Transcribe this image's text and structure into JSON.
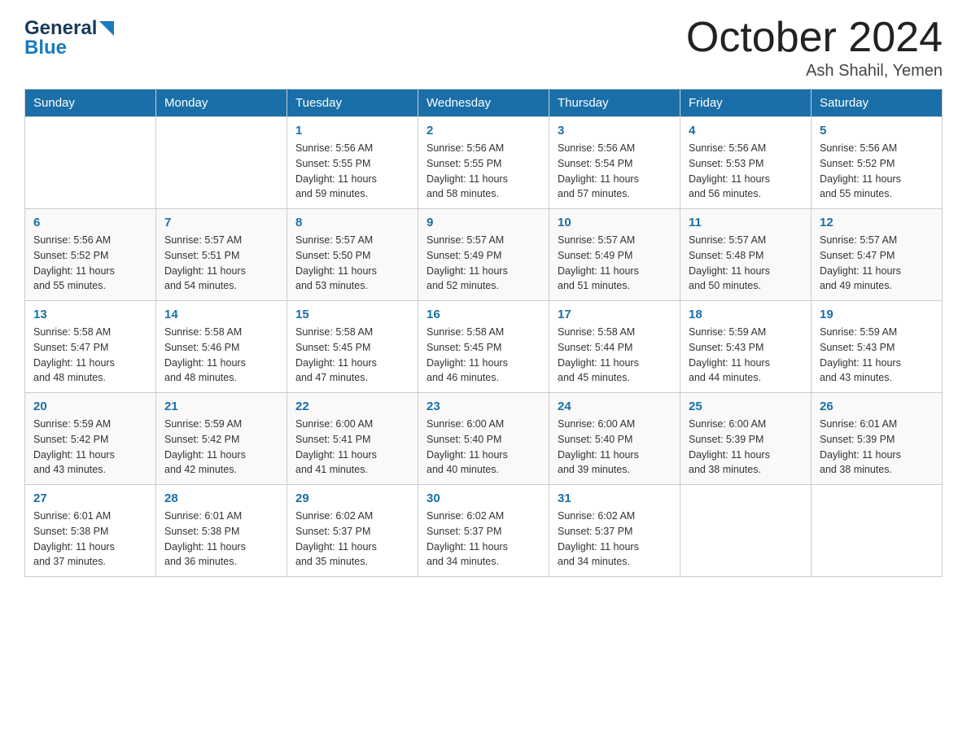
{
  "logo": {
    "general": "General",
    "blue": "Blue"
  },
  "title": "October 2024",
  "location": "Ash Shahil, Yemen",
  "weekdays": [
    "Sunday",
    "Monday",
    "Tuesday",
    "Wednesday",
    "Thursday",
    "Friday",
    "Saturday"
  ],
  "weeks": [
    [
      {
        "day": "",
        "info": ""
      },
      {
        "day": "",
        "info": ""
      },
      {
        "day": "1",
        "info": "Sunrise: 5:56 AM\nSunset: 5:55 PM\nDaylight: 11 hours\nand 59 minutes."
      },
      {
        "day": "2",
        "info": "Sunrise: 5:56 AM\nSunset: 5:55 PM\nDaylight: 11 hours\nand 58 minutes."
      },
      {
        "day": "3",
        "info": "Sunrise: 5:56 AM\nSunset: 5:54 PM\nDaylight: 11 hours\nand 57 minutes."
      },
      {
        "day": "4",
        "info": "Sunrise: 5:56 AM\nSunset: 5:53 PM\nDaylight: 11 hours\nand 56 minutes."
      },
      {
        "day": "5",
        "info": "Sunrise: 5:56 AM\nSunset: 5:52 PM\nDaylight: 11 hours\nand 55 minutes."
      }
    ],
    [
      {
        "day": "6",
        "info": "Sunrise: 5:56 AM\nSunset: 5:52 PM\nDaylight: 11 hours\nand 55 minutes."
      },
      {
        "day": "7",
        "info": "Sunrise: 5:57 AM\nSunset: 5:51 PM\nDaylight: 11 hours\nand 54 minutes."
      },
      {
        "day": "8",
        "info": "Sunrise: 5:57 AM\nSunset: 5:50 PM\nDaylight: 11 hours\nand 53 minutes."
      },
      {
        "day": "9",
        "info": "Sunrise: 5:57 AM\nSunset: 5:49 PM\nDaylight: 11 hours\nand 52 minutes."
      },
      {
        "day": "10",
        "info": "Sunrise: 5:57 AM\nSunset: 5:49 PM\nDaylight: 11 hours\nand 51 minutes."
      },
      {
        "day": "11",
        "info": "Sunrise: 5:57 AM\nSunset: 5:48 PM\nDaylight: 11 hours\nand 50 minutes."
      },
      {
        "day": "12",
        "info": "Sunrise: 5:57 AM\nSunset: 5:47 PM\nDaylight: 11 hours\nand 49 minutes."
      }
    ],
    [
      {
        "day": "13",
        "info": "Sunrise: 5:58 AM\nSunset: 5:47 PM\nDaylight: 11 hours\nand 48 minutes."
      },
      {
        "day": "14",
        "info": "Sunrise: 5:58 AM\nSunset: 5:46 PM\nDaylight: 11 hours\nand 48 minutes."
      },
      {
        "day": "15",
        "info": "Sunrise: 5:58 AM\nSunset: 5:45 PM\nDaylight: 11 hours\nand 47 minutes."
      },
      {
        "day": "16",
        "info": "Sunrise: 5:58 AM\nSunset: 5:45 PM\nDaylight: 11 hours\nand 46 minutes."
      },
      {
        "day": "17",
        "info": "Sunrise: 5:58 AM\nSunset: 5:44 PM\nDaylight: 11 hours\nand 45 minutes."
      },
      {
        "day": "18",
        "info": "Sunrise: 5:59 AM\nSunset: 5:43 PM\nDaylight: 11 hours\nand 44 minutes."
      },
      {
        "day": "19",
        "info": "Sunrise: 5:59 AM\nSunset: 5:43 PM\nDaylight: 11 hours\nand 43 minutes."
      }
    ],
    [
      {
        "day": "20",
        "info": "Sunrise: 5:59 AM\nSunset: 5:42 PM\nDaylight: 11 hours\nand 43 minutes."
      },
      {
        "day": "21",
        "info": "Sunrise: 5:59 AM\nSunset: 5:42 PM\nDaylight: 11 hours\nand 42 minutes."
      },
      {
        "day": "22",
        "info": "Sunrise: 6:00 AM\nSunset: 5:41 PM\nDaylight: 11 hours\nand 41 minutes."
      },
      {
        "day": "23",
        "info": "Sunrise: 6:00 AM\nSunset: 5:40 PM\nDaylight: 11 hours\nand 40 minutes."
      },
      {
        "day": "24",
        "info": "Sunrise: 6:00 AM\nSunset: 5:40 PM\nDaylight: 11 hours\nand 39 minutes."
      },
      {
        "day": "25",
        "info": "Sunrise: 6:00 AM\nSunset: 5:39 PM\nDaylight: 11 hours\nand 38 minutes."
      },
      {
        "day": "26",
        "info": "Sunrise: 6:01 AM\nSunset: 5:39 PM\nDaylight: 11 hours\nand 38 minutes."
      }
    ],
    [
      {
        "day": "27",
        "info": "Sunrise: 6:01 AM\nSunset: 5:38 PM\nDaylight: 11 hours\nand 37 minutes."
      },
      {
        "day": "28",
        "info": "Sunrise: 6:01 AM\nSunset: 5:38 PM\nDaylight: 11 hours\nand 36 minutes."
      },
      {
        "day": "29",
        "info": "Sunrise: 6:02 AM\nSunset: 5:37 PM\nDaylight: 11 hours\nand 35 minutes."
      },
      {
        "day": "30",
        "info": "Sunrise: 6:02 AM\nSunset: 5:37 PM\nDaylight: 11 hours\nand 34 minutes."
      },
      {
        "day": "31",
        "info": "Sunrise: 6:02 AM\nSunset: 5:37 PM\nDaylight: 11 hours\nand 34 minutes."
      },
      {
        "day": "",
        "info": ""
      },
      {
        "day": "",
        "info": ""
      }
    ]
  ]
}
